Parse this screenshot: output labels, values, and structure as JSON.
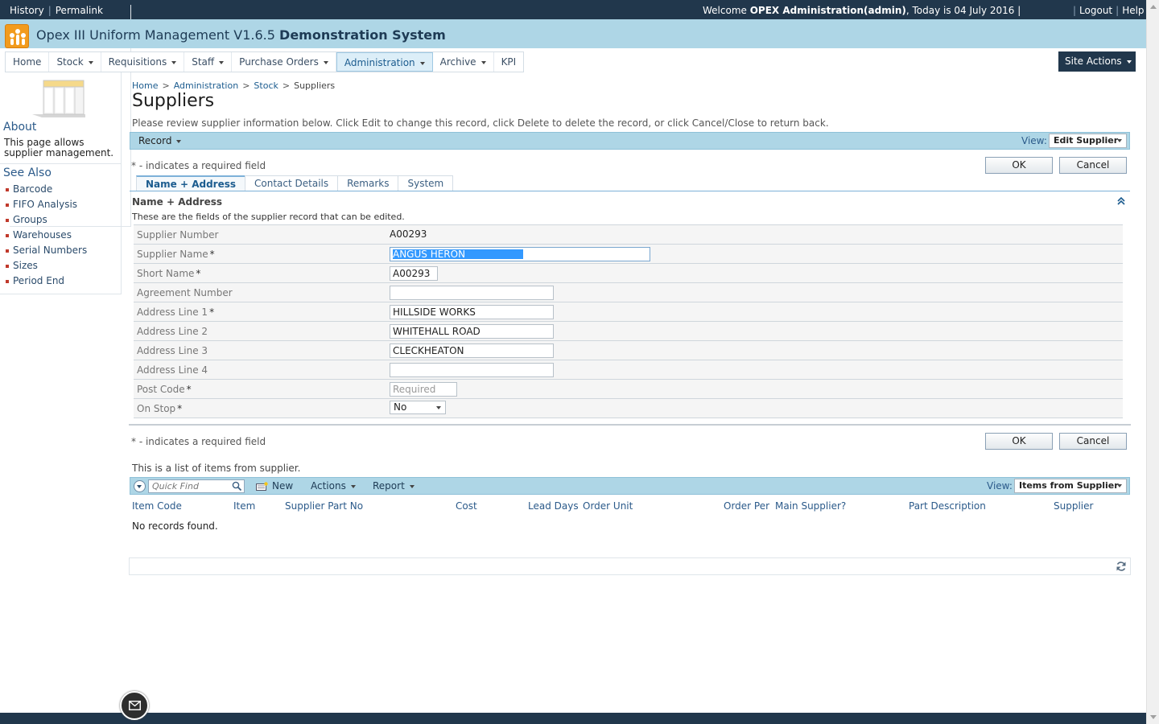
{
  "topbar": {
    "history": "History",
    "permalink": "Permalink",
    "welcome_prefix": "Welcome",
    "welcome_user": "OPEX Administration(admin)",
    "welcome_suffix": ", Today is 04 July 2016 |",
    "sep_pipe": "|",
    "logout": "Logout",
    "help": "Help"
  },
  "app": {
    "title_plain": "Opex III Uniform Management V1.6.5",
    "title_bold": "Demonstration System",
    "logo_color": "#f29b1d"
  },
  "nav": {
    "items": [
      {
        "label": "Home"
      },
      {
        "label": "Stock"
      },
      {
        "label": "Requisitions"
      },
      {
        "label": "Staff"
      },
      {
        "label": "Purchase Orders"
      },
      {
        "label": "Administration"
      },
      {
        "label": "Archive"
      },
      {
        "label": "KPI"
      }
    ],
    "site_actions": "Site Actions"
  },
  "sidebar": {
    "about_heading": "About",
    "about_text": "This page allows supplier management.",
    "see_also_heading": "See Also",
    "links": [
      "Barcode",
      "FIFO Analysis",
      "Groups",
      "Warehouses",
      "Serial Numbers",
      "Sizes",
      "Period End"
    ]
  },
  "breadcrumb": {
    "home": "Home",
    "gt": ">",
    "admin": "Administration",
    "stock": "Stock",
    "current": "Suppliers"
  },
  "page": {
    "title": "Suppliers",
    "instructions": "Please review supplier information below. Click Edit to change this record, click Delete to delete the record, or click Cancel/Close to return back."
  },
  "ribbon": {
    "record": "Record",
    "view_label": "View:",
    "view_value": "Edit Supplier"
  },
  "form": {
    "required_note": "* - indicates a required field",
    "ok": "OK",
    "cancel": "Cancel",
    "tabs": [
      "Name + Address",
      "Contact Details",
      "Remarks",
      "System"
    ],
    "section_title": "Name + Address",
    "section_desc": "These are the fields of the supplier record that can be edited.",
    "collapse_glyph": "⌃",
    "star": "*",
    "fields": {
      "supplier_number": {
        "label": "Supplier Number",
        "value": "A00293"
      },
      "supplier_name": {
        "label": "Supplier Name",
        "value": "ANGUS HERON"
      },
      "short_name": {
        "label": "Short Name",
        "value": "A00293"
      },
      "agreement_number": {
        "label": "Agreement Number",
        "value": ""
      },
      "address1": {
        "label": "Address Line 1",
        "value": "HILLSIDE WORKS"
      },
      "address2": {
        "label": "Address Line 2",
        "value": "WHITEHALL ROAD"
      },
      "address3": {
        "label": "Address Line 3",
        "value": "CLECKHEATON"
      },
      "address4": {
        "label": "Address Line 4",
        "value": ""
      },
      "post_code": {
        "label": "Post Code",
        "placeholder": "Required"
      },
      "on_stop": {
        "label": "On Stop",
        "value": "No"
      }
    }
  },
  "list": {
    "intro": "This is a list of items from supplier.",
    "quick_find_placeholder": "Quick Find",
    "new": "New",
    "actions": "Actions",
    "report": "Report",
    "view_label": "View:",
    "view_value": "Items from Supplier",
    "columns": [
      "Item Code",
      "Item",
      "Supplier Part No",
      "Cost",
      "Lead Days",
      "Order Unit",
      "Order Per",
      "Main Supplier?",
      "Part Description",
      "Supplier"
    ],
    "empty": "No records found."
  }
}
